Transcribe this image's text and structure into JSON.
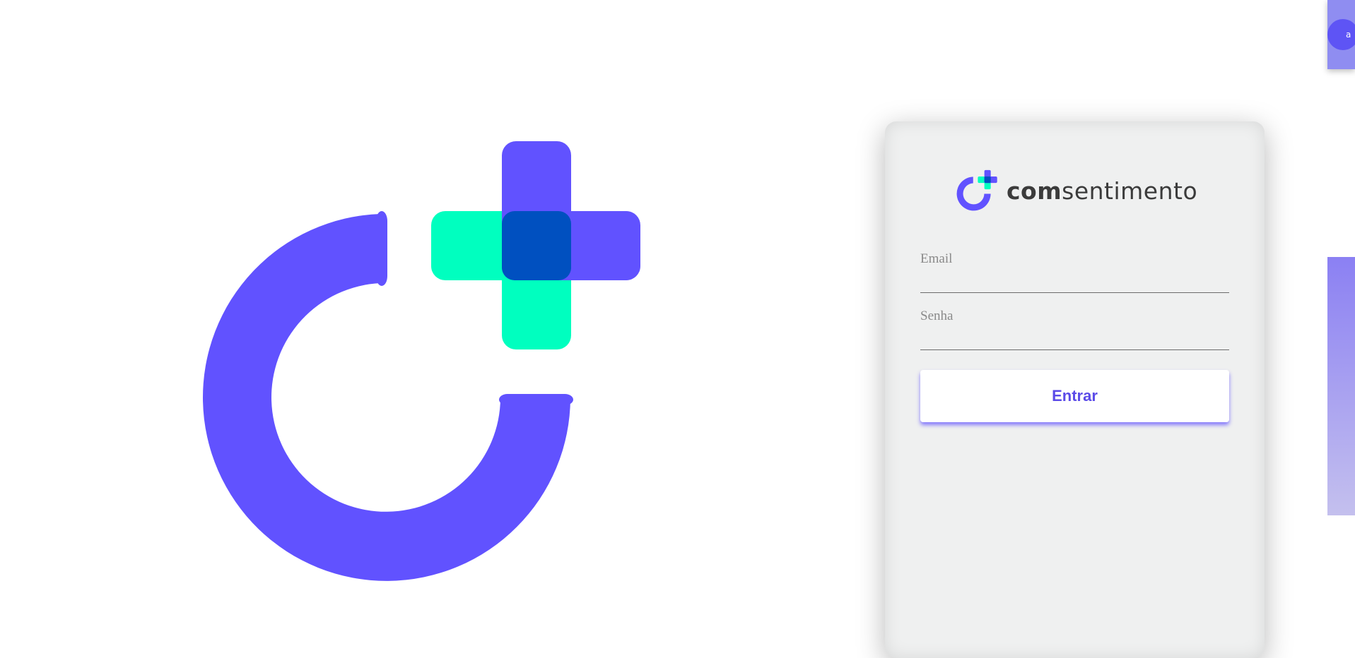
{
  "colors": {
    "brand_purple": "#6152FF",
    "brand_green": "#00FFBF",
    "overlap_blue": "#0050C0",
    "card_bg": "#EFF0F0",
    "button_text": "#5B4BE8"
  },
  "hero": {
    "logo_icon": "comsentimento-logo-mark"
  },
  "login": {
    "brand": {
      "icon": "comsentimento-logo-mark",
      "name_bold": "com",
      "name_regular": "sentimento"
    },
    "email": {
      "label": "Email",
      "value": "",
      "placeholder": ""
    },
    "password": {
      "label": "Senha",
      "value": "",
      "placeholder": ""
    },
    "submit_label": "Entrar"
  },
  "floating_button": {
    "icon": "accessibility-icon",
    "glyph": "a"
  },
  "side_panel": {
    "icon": "side-tab-panel"
  }
}
